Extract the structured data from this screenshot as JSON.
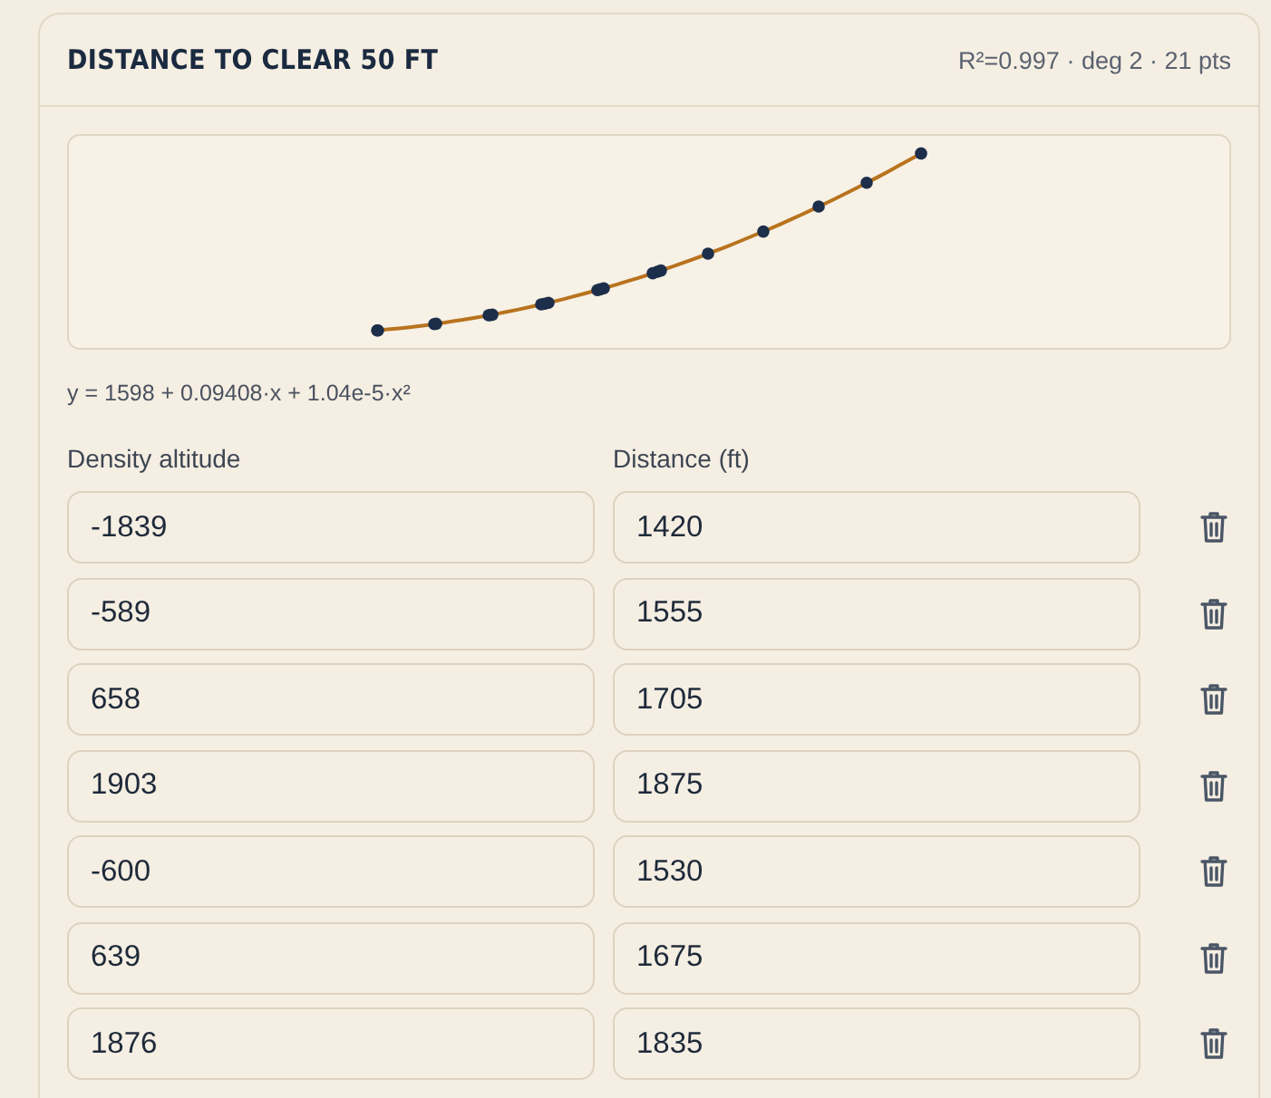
{
  "card": {
    "title": "DISTANCE TO CLEAR 50 FT",
    "summary": "R²=0.997 · deg 2 · 21 pts"
  },
  "formula": "y = 1598 + 0.09408·x + 1.04e-5·x²",
  "columns": [
    "Density altitude",
    "Distance (ft)"
  ],
  "rows": [
    {
      "altitude": "-1839",
      "distance": "1420"
    },
    {
      "altitude": "-589",
      "distance": "1555"
    },
    {
      "altitude": "658",
      "distance": "1705"
    },
    {
      "altitude": "1903",
      "distance": "1875"
    },
    {
      "altitude": "-600",
      "distance": "1530"
    },
    {
      "altitude": "639",
      "distance": "1675"
    },
    {
      "altitude": "1876",
      "distance": "1835"
    }
  ]
}
